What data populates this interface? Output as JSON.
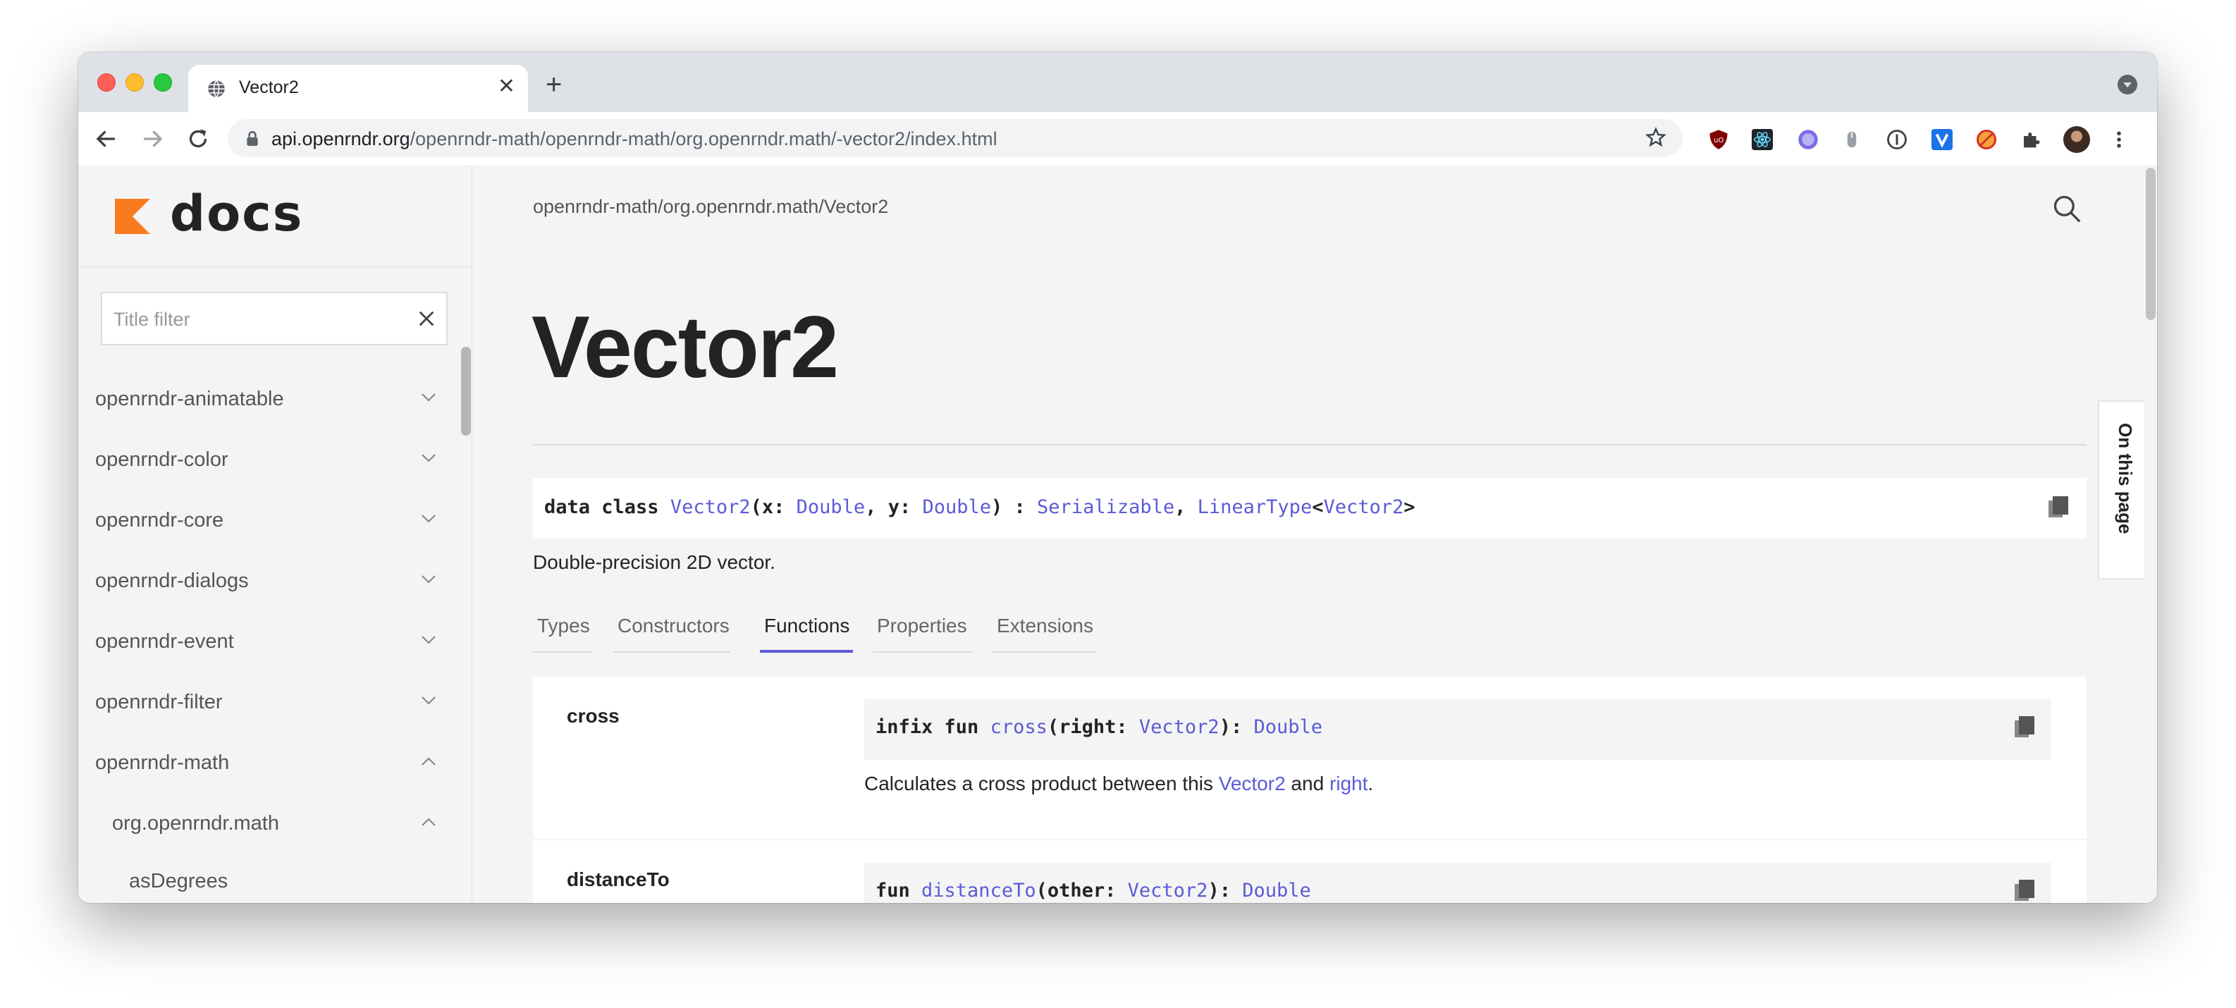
{
  "browser": {
    "tab_title": "Vector2",
    "url_host": "api.openrndr.org",
    "url_path": "/openrndr-math/openrndr-math/org.openrndr.math/-vector2/index.html",
    "extensions": [
      "ublock-origin-icon",
      "react-devtools-icon",
      "vue-devtools-icon",
      "mouse-icon",
      "onepassword-icon",
      "vimium-icon",
      "no-tracking-icon",
      "puzzle-extensions-icon",
      "profile-avatar",
      "more-menu-icon"
    ]
  },
  "sidebar": {
    "logo_text": "docs",
    "filter_placeholder": "Title filter",
    "items": [
      {
        "label": "openrndr-animatable",
        "expanded": false
      },
      {
        "label": "openrndr-color",
        "expanded": false
      },
      {
        "label": "openrndr-core",
        "expanded": false
      },
      {
        "label": "openrndr-dialogs",
        "expanded": false
      },
      {
        "label": "openrndr-event",
        "expanded": false
      },
      {
        "label": "openrndr-filter",
        "expanded": false
      },
      {
        "label": "openrndr-math",
        "expanded": true
      },
      {
        "label": "org.openrndr.math",
        "expanded": true
      },
      {
        "label": "asDegrees",
        "expanded": false
      }
    ]
  },
  "main": {
    "breadcrumb": "openrndr-math/org.openrndr.math/Vector2",
    "title": "Vector2",
    "signature": {
      "p1": "data class ",
      "name": "Vector2",
      "p2": "(x: ",
      "t1": "Double",
      "p3": ", y: ",
      "t2": "Double",
      "p4": ") : ",
      "t3": "Serializable",
      "p5": ", ",
      "t4": "LinearType",
      "p6": "<",
      "t5": "Vector2",
      "p7": ">"
    },
    "description": "Double-precision 2D vector.",
    "tabs": [
      "Types",
      "Constructors",
      "Functions",
      "Properties",
      "Extensions"
    ],
    "active_tab": "Functions",
    "on_this_page": "On this page",
    "functions": [
      {
        "name": "cross",
        "sig": {
          "p1": "infix fun ",
          "fn": "cross",
          "p2": "(right: ",
          "t1": "Vector2",
          "p3": "): ",
          "t2": "Double"
        },
        "desc": {
          "pre": "Calculates a cross product between this ",
          "l1": "Vector2",
          "mid": " and ",
          "l2": "right",
          "post": "."
        }
      },
      {
        "name": "distanceTo",
        "sig": {
          "p1": "fun ",
          "fn": "distanceTo",
          "p2": "(other: ",
          "t1": "Vector2",
          "p3": "): ",
          "t2": "Double"
        }
      }
    ]
  },
  "colors": {
    "link": "#5b5bd6",
    "text": "#232323",
    "background": "#f4f4f4",
    "logo_orange": "#f87c1f"
  }
}
